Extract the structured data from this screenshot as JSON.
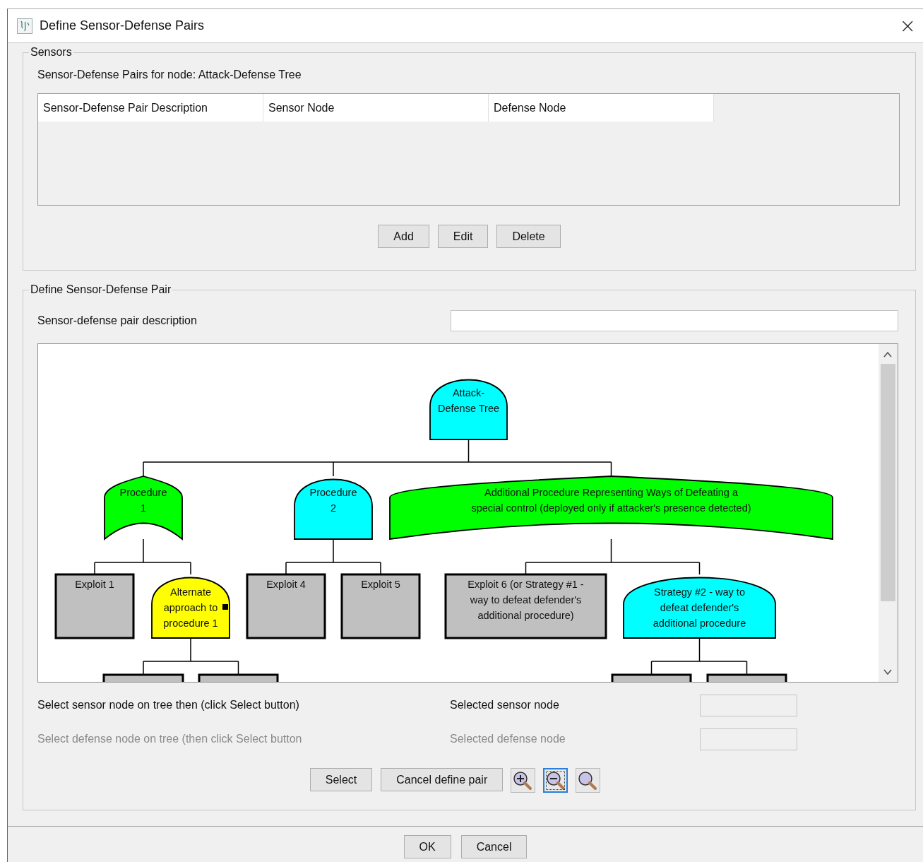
{
  "window": {
    "title": "Define Sensor-Defense Pairs",
    "close": "×"
  },
  "sensors": {
    "legend": "Sensors",
    "caption": "Sensor-Defense Pairs for node: Attack-Defense Tree",
    "table": {
      "columns": [
        "Sensor-Defense Pair Description",
        "Sensor Node",
        "Defense Node"
      ]
    },
    "buttons": [
      "Add",
      "Edit",
      "Delete"
    ]
  },
  "define": {
    "legend": "Define Sensor-Defense Pair",
    "description_label": "Sensor-defense pair description",
    "tree": {
      "kind": "and",
      "color": "#00ffff",
      "selected": false,
      "label": [
        "Attack-",
        "Defense Tree"
      ],
      "children": [
        {
          "kind": "or",
          "color": "#00ff00",
          "selected": false,
          "label": [
            "Procedure",
            "1"
          ],
          "children": [
            {
              "kind": "leaf",
              "color": "#c0c0c0",
              "selected": false,
              "label": [
                "Exploit 1"
              ]
            },
            {
              "kind": "and",
              "color": "#ffff00",
              "selected": true,
              "label": [
                "Alternate",
                "approach to",
                "procedure 1"
              ],
              "children": [
                {
                  "kind": "leaf",
                  "color": "#c0c0c0",
                  "selected": false
                },
                {
                  "kind": "leaf",
                  "color": "#c0c0c0",
                  "selected": false
                }
              ]
            }
          ]
        },
        {
          "kind": "and",
          "color": "#00ffff",
          "selected": false,
          "label": [
            "Procedure",
            "2"
          ],
          "children": [
            {
              "kind": "leaf",
              "color": "#c0c0c0",
              "selected": false,
              "label": [
                "Exploit 4"
              ]
            },
            {
              "kind": "leaf",
              "color": "#c0c0c0",
              "selected": false,
              "label": [
                "Exploit 5"
              ]
            }
          ]
        },
        {
          "kind": "or",
          "color": "#00ff00",
          "selected": false,
          "label": [
            "Additional Procedure Representing Ways of Defeating a",
            "special control (deployed only if attacker's presence detected)"
          ],
          "children": [
            {
              "kind": "leaf",
              "color": "#c0c0c0",
              "selected": false,
              "label": [
                "Exploit 6 (or Strategy #1 -",
                "way to defeat defender's",
                "additional procedure)"
              ]
            },
            {
              "kind": "and",
              "color": "#00ffff",
              "selected": false,
              "label": [
                "Strategy #2 - way to",
                "defeat defender's",
                "additional procedure"
              ],
              "children": [
                {
                  "kind": "leaf",
                  "color": "#c0c0c0",
                  "selected": false
                },
                {
                  "kind": "leaf",
                  "color": "#c0c0c0",
                  "selected": false
                }
              ]
            }
          ]
        }
      ]
    },
    "selections": [
      {
        "instruction": "Select sensor node on tree then (click Select button)",
        "field_label": "Selected sensor node",
        "disabled": false
      },
      {
        "instruction": "Select defense node on tree (then click Select button",
        "field_label": "Selected defense node",
        "disabled": true
      }
    ],
    "buttons": [
      "Select",
      "Cancel define pair"
    ],
    "zoom_tools": [
      {
        "kind": "zoom-in",
        "focused": false
      },
      {
        "kind": "zoom-out",
        "focused": true
      },
      {
        "kind": "zoom-reset",
        "focused": false
      }
    ]
  },
  "buttons": [
    "OK",
    "Cancel"
  ]
}
